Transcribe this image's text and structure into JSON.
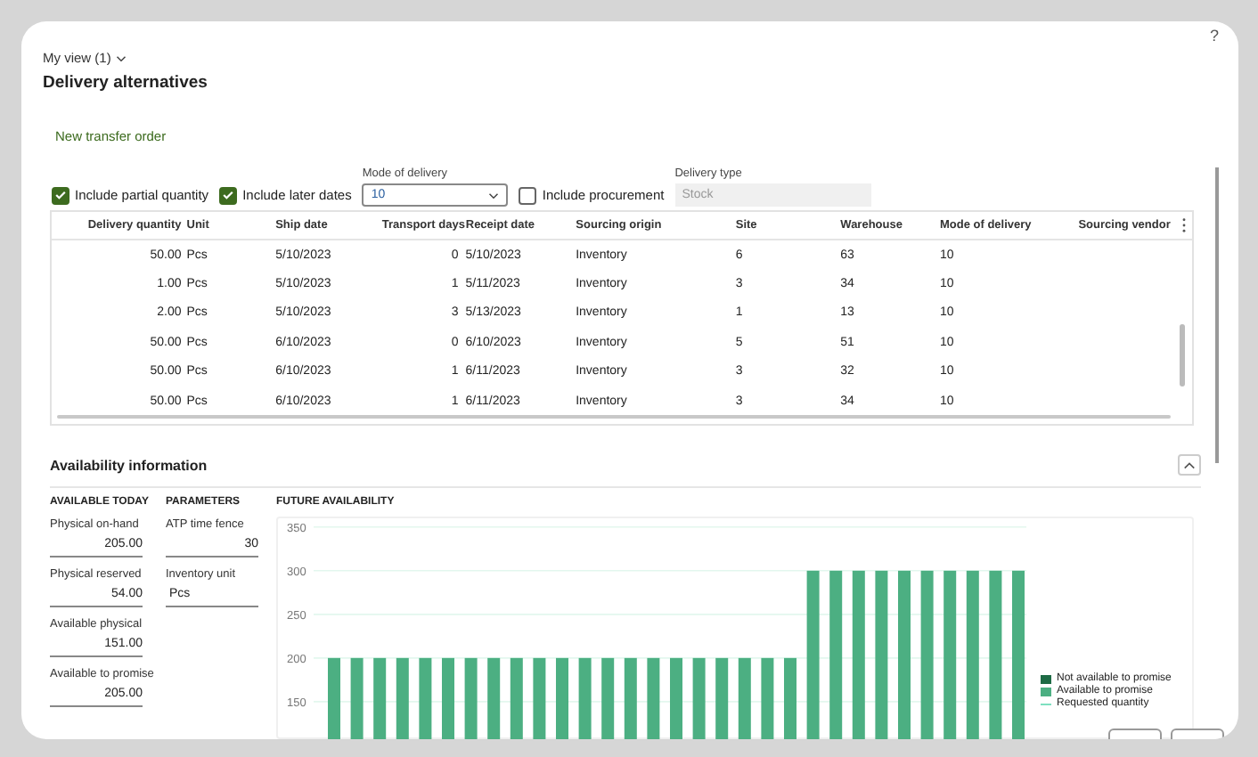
{
  "window": {
    "help": "?"
  },
  "view_selector": {
    "label": "My view (1)"
  },
  "title": "Delivery alternatives",
  "actions": [
    {
      "label": "New transfer order"
    }
  ],
  "filters": [
    {
      "kind": "checkbox",
      "label": "Include partial quantity",
      "checked": true
    },
    {
      "kind": "checkbox",
      "label": "Include later dates",
      "checked": true
    },
    {
      "kind": "dropdown",
      "label": "Mode of delivery",
      "value": "10"
    },
    {
      "kind": "checkbox",
      "label": "Include procurement",
      "checked": false
    },
    {
      "kind": "readonly",
      "label": "Delivery type",
      "value": "Stock"
    }
  ],
  "table": {
    "columns": [
      "Delivery quantity",
      "Unit",
      "Ship date",
      "Transport days",
      "Receipt date",
      "Sourcing origin",
      "Site",
      "Warehouse",
      "Mode of delivery",
      "Sourcing vendor"
    ],
    "rows": [
      [
        "50.00",
        "Pcs",
        "5/10/2023",
        "0",
        "5/10/2023",
        "Inventory",
        "6",
        "63",
        "10",
        ""
      ],
      [
        "1.00",
        "Pcs",
        "5/10/2023",
        "1",
        "5/11/2023",
        "Inventory",
        "3",
        "34",
        "10",
        ""
      ],
      [
        "2.00",
        "Pcs",
        "5/10/2023",
        "3",
        "5/13/2023",
        "Inventory",
        "1",
        "13",
        "10",
        ""
      ],
      [
        "50.00",
        "Pcs",
        "6/10/2023",
        "0",
        "6/10/2023",
        "Inventory",
        "5",
        "51",
        "10",
        ""
      ],
      [
        "50.00",
        "Pcs",
        "6/10/2023",
        "1",
        "6/11/2023",
        "Inventory",
        "3",
        "32",
        "10",
        ""
      ],
      [
        "50.00",
        "Pcs",
        "6/10/2023",
        "1",
        "6/11/2023",
        "Inventory",
        "3",
        "34",
        "10",
        ""
      ]
    ]
  },
  "availability": {
    "title": "Availability information",
    "expanded": true,
    "available_today": {
      "heading": "AVAILABLE TODAY",
      "fields": [
        {
          "label": "Physical on-hand",
          "value": "205.00"
        },
        {
          "label": "Physical reserved",
          "value": "54.00"
        },
        {
          "label": "Available physical",
          "value": "151.00"
        },
        {
          "label": "Available to promise",
          "value": "205.00"
        }
      ]
    },
    "parameters": {
      "heading": "PARAMETERS",
      "fields": [
        {
          "kind": "number",
          "label": "ATP time fence",
          "value": "30"
        },
        {
          "kind": "text",
          "label": "Inventory unit",
          "value": "Pcs"
        }
      ]
    },
    "future": {
      "heading": "FUTURE AVAILABILITY",
      "chart_data": {
        "type": "bar",
        "grid": true,
        "ylim": [
          105,
          360
        ],
        "yticks": [
          150,
          200,
          250,
          300,
          350
        ],
        "series": [
          {
            "name": "Available to promise",
            "color": "#4caf82",
            "values": [
              200,
              200,
              200,
              200,
              200,
              200,
              200,
              200,
              200,
              200,
              200,
              200,
              200,
              200,
              200,
              200,
              200,
              200,
              200,
              200,
              200,
              300,
              300,
              300,
              300,
              300,
              300,
              300,
              300,
              300,
              300
            ]
          }
        ]
      },
      "legend": [
        {
          "kind": "swatch",
          "label": "Not available to promise",
          "color": "#1e6b45"
        },
        {
          "kind": "series"
        },
        {
          "kind": "line",
          "label": "Requested quantity",
          "color": "#7fe0c0"
        }
      ]
    }
  }
}
